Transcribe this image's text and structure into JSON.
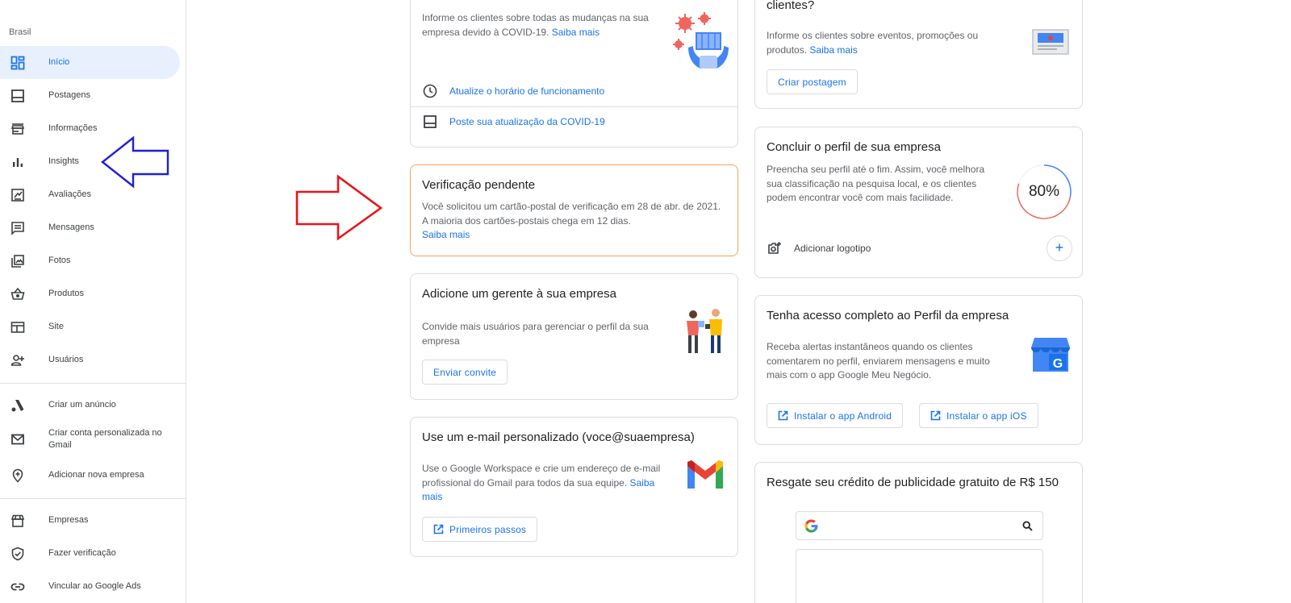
{
  "sidebar": {
    "region": "Brasil",
    "items": [
      {
        "label": "Início"
      },
      {
        "label": "Postagens"
      },
      {
        "label": "Informações"
      },
      {
        "label": "Insights"
      },
      {
        "label": "Avaliações"
      },
      {
        "label": "Mensagens"
      },
      {
        "label": "Fotos"
      },
      {
        "label": "Produtos"
      },
      {
        "label": "Site"
      },
      {
        "label": "Usuários"
      }
    ],
    "extra": [
      {
        "label": "Criar um anúncio"
      },
      {
        "label": "Criar conta personalizada no Gmail"
      },
      {
        "label": "Adicionar nova empresa"
      }
    ],
    "bottom": [
      {
        "label": "Empresas"
      },
      {
        "label": "Fazer verificação"
      },
      {
        "label": "Vincular ao Google Ads"
      }
    ]
  },
  "covid": {
    "text": "Informe os clientes sobre todas as mudanças na sua empresa devido à COVID-19.",
    "link": "Saiba mais",
    "row1": "Atualize o horário de funcionamento",
    "row2": "Poste sua atualização da COVID-19"
  },
  "verification": {
    "title": "Verificação pendente",
    "text1": "Você solicitou um cartão-postal de verificação em 28 de abr. de 2021.",
    "text2": "A maioria dos cartões-postais chega em 12 dias.",
    "link": "Saiba mais"
  },
  "manager": {
    "title": "Adicione um gerente à sua empresa",
    "text": "Convide mais usuários para gerenciar o perfil da sua empresa",
    "button": "Enviar convite"
  },
  "email": {
    "title": "Use um e-mail personalizado (voce@suaempresa)",
    "text": "Use o Google Workspace e crie um endereço de e-mail profissional do Gmail para todos da sua equipe.",
    "link": "Saiba mais",
    "button": "Primeiros passos"
  },
  "posts": {
    "title": "clientes?",
    "text": "Informe os clientes sobre eventos, promoções ou produtos.",
    "link": "Saiba mais",
    "button": "Criar postagem"
  },
  "profile": {
    "title": "Concluir o perfil de sua empresa",
    "text": "Preencha seu perfil até o fim. Assim, você melhora sua classificação na pesquisa local, e os clientes podem encontrar você com mais facilidade.",
    "percent_label": "80%",
    "percent": 80,
    "row": "Adicionar logotipo"
  },
  "app": {
    "title": "Tenha acesso completo ao Perfil da empresa",
    "text": "Receba alertas instantâneos quando os clientes comentarem no perfil, enviarem mensagens e muito mais com o app Google Meu Negócio.",
    "android": "Instalar o app Android",
    "ios": "Instalar o app iOS"
  },
  "credit": {
    "title": "Resgate seu crédito de publicidade gratuito de R$ 150"
  },
  "colors": {
    "accent": "#1a73e8",
    "active_bg": "#e8f0fe",
    "warn_border": "#f7a35c",
    "annotation_blue": "#1f1fd6",
    "annotation_red": "#e8141a"
  }
}
